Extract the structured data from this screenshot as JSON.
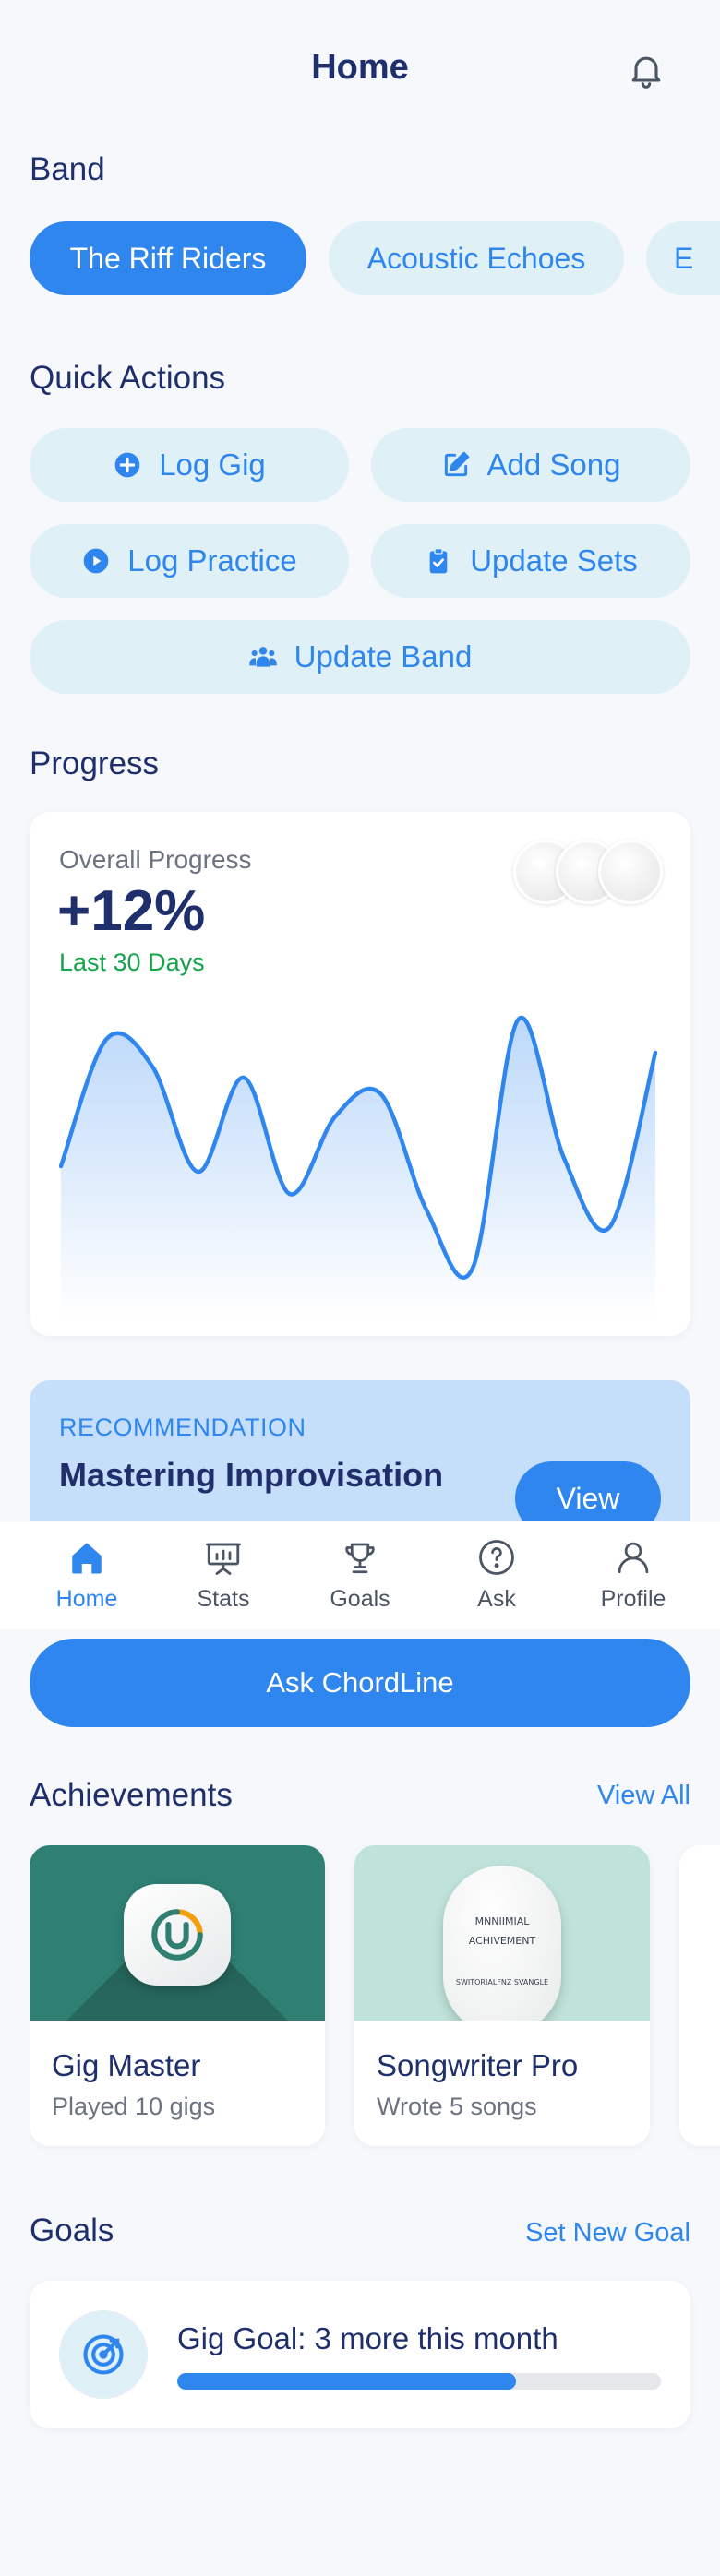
{
  "header": {
    "title": "Home"
  },
  "band": {
    "title": "Band",
    "chips": [
      {
        "label": "The Riff Riders",
        "active": true
      },
      {
        "label": "Acoustic Echoes",
        "active": false
      },
      {
        "label": "E",
        "active": false
      }
    ]
  },
  "quick_actions": {
    "title": "Quick Actions",
    "items": [
      {
        "label": "Log Gig",
        "icon": "plus-circle-icon"
      },
      {
        "label": "Add Song",
        "icon": "edit-icon"
      },
      {
        "label": "Log Practice",
        "icon": "play-circle-icon"
      },
      {
        "label": "Update Sets",
        "icon": "clipboard-icon"
      },
      {
        "label": "Update Band",
        "icon": "users-icon"
      }
    ]
  },
  "progress": {
    "title": "Progress",
    "label": "Overall Progress",
    "value": "+12%",
    "period": "Last 30 Days",
    "accent": "#2e86ee",
    "positive_color": "#16a34a",
    "chart_data": {
      "type": "area",
      "y": [
        42,
        88,
        78,
        40,
        74,
        32,
        60,
        68,
        26,
        5,
        95,
        45,
        20,
        83
      ]
    }
  },
  "recommendation": {
    "eyebrow": "RECOMMENDATION",
    "title": "Mastering Improvisation",
    "button": "View"
  },
  "tabbar": {
    "items": [
      {
        "label": "Home",
        "icon": "home-icon",
        "active": true
      },
      {
        "label": "Stats",
        "icon": "presentation-chart-icon",
        "active": false
      },
      {
        "label": "Goals",
        "icon": "trophy-icon",
        "active": false
      },
      {
        "label": "Ask",
        "icon": "question-circle-icon",
        "active": false
      },
      {
        "label": "Profile",
        "icon": "user-icon",
        "active": false
      }
    ]
  },
  "ask_button": "Ask ChordLine",
  "achievements": {
    "title": "Achievements",
    "view_all": "View All",
    "items": [
      {
        "title": "Gig Master",
        "subtitle": "Played 10 gigs",
        "badge_color": "#2f7f73"
      },
      {
        "title": "Songwriter Pro",
        "subtitle": "Wrote 5 songs",
        "badge_color": "#bfe3da",
        "badge_text_1": "MNNIIMIAL",
        "badge_text_2": "ACHIVEMENT",
        "badge_text_3": "SWITORIALFNZ SVANGLE"
      }
    ]
  },
  "goals": {
    "title": "Goals",
    "action": "Set New Goal",
    "items": [
      {
        "title": "Gig Goal: 3 more this month",
        "progress": 0.7
      }
    ]
  }
}
